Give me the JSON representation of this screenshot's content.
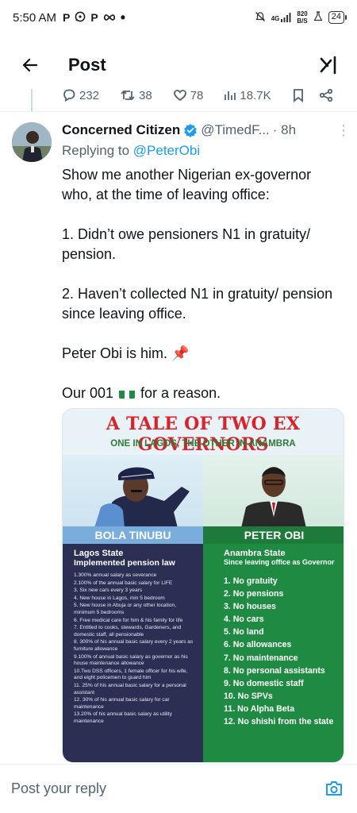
{
  "status_bar": {
    "time": "5:50 AM",
    "left_icons": [
      "P",
      "whatsapp-icon",
      "P",
      "infinity-icon",
      "•"
    ],
    "network": "4G",
    "speed_value": "820",
    "speed_unit": "B/S",
    "battery": "24"
  },
  "header": {
    "title": "Post"
  },
  "prev_actions": {
    "replies": "232",
    "reposts": "38",
    "likes": "78",
    "views": "18.7K"
  },
  "tweet": {
    "author_name": "Concerned Citizen",
    "handle": "@TimedF...",
    "time": "· 8h",
    "replying_prefix": "Replying to ",
    "replying_to": "@PeterObi",
    "para1": "Show me another Nigerian ex-governor who, at the time of leaving office:",
    "para2": "1. Didn’t owe pensioners N1 in gratuity/ pension.",
    "para3": "2. Haven’t collected N1 in gratuity/ pension since leaving office.",
    "para4": "Peter Obi is him. 📌",
    "para5_before": "Our 001 ",
    "para5_after": " for a reason."
  },
  "media": {
    "title": "A TALE OF TWO EX GOVERNORS",
    "subtitle": "ONE IN LAGOS, THE OTHER IN ANAMBRA",
    "left_name": "BOLA TINUBU",
    "right_name": "PETER OBI",
    "left_state": "Lagos State",
    "left_sub": "Implemented pension law",
    "left_items": [
      "1.300% annual salary as severance",
      "2.100% of the annual basic salary for LIFE",
      "3. Six new cars every 3 years",
      "4. New house in Lagos, min 5 bedroom",
      "5. New house in Abuja or any other location, minimum 5 bedrooms",
      "6. Free medical care for him & his family for life",
      "7. Entitled to cooks, stewards, Gardeners, and domestic staff, all pensionable",
      "8. 300% of his annual basic salary every 2 years as furniture allowance",
      "9.100% of annual basic salary as governor as his house maintenance allowance",
      "10.Two DSS officers, 1 female officer for his wife, and eight policemen to guard him",
      "11. 25% of his annual basic salary for a personal assistant",
      "12. 30% of his annual basic salary for car maintenance",
      "13.20% of his annual basic salary as utility maintenance"
    ],
    "right_state": "Anambra State",
    "right_sub": "Since leaving office as Governor",
    "right_items": [
      "1. No gratuity",
      "2. No pensions",
      "3. No houses",
      "4. No cars",
      "5. No land",
      "6. No allowances",
      "7. No maintenance",
      "8. No personal assistants",
      "9. No domestic staff",
      "10. No SPVs",
      "11. No Alpha Beta",
      "12. No shishi from the state"
    ]
  },
  "reply": {
    "placeholder": "Post your reply"
  },
  "colors": {
    "accent": "#1d9bf0",
    "muted": "#536471",
    "title_red": "#d8232a",
    "left_panel": "#2a2f53",
    "right_panel": "#1f8a42"
  }
}
